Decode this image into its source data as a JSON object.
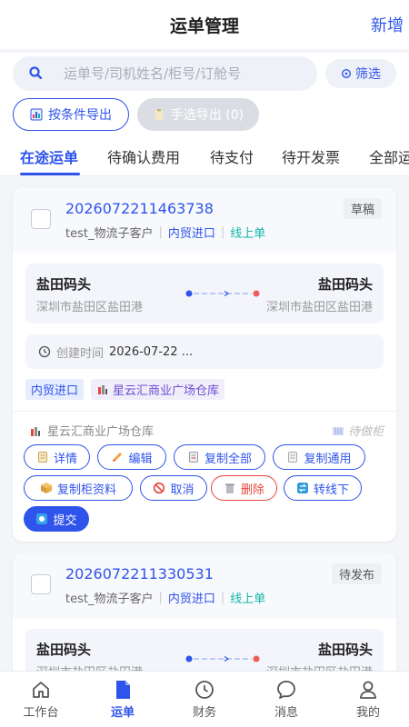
{
  "header": {
    "title": "运单管理",
    "add_label": "新增"
  },
  "search": {
    "placeholder": "运单号/司机姓名/柜号/订舱号",
    "filter_label": "筛选"
  },
  "export": {
    "by_condition": "按条件导出",
    "manual": "手选导出 (0)"
  },
  "tabs": [
    {
      "label": "在途运单",
      "active": true
    },
    {
      "label": "待确认费用"
    },
    {
      "label": "待支付"
    },
    {
      "label": "待开发票"
    },
    {
      "label": "全部运"
    }
  ],
  "orders": [
    {
      "order_no": "2026072211463738",
      "status": "草稿",
      "customer": "test_物流子客户",
      "trade_type": "内贸进口",
      "channel": "线上单",
      "from_name": "盐田码头",
      "from_addr": "深圳市盐田区盐田港",
      "to_name": "盐田码头",
      "to_addr": "深圳市盐田区盐田港",
      "created_label": "创建时间",
      "created_value": "2026-07-22 ...",
      "tag_trade": "内贸进口",
      "tag_warehouse": "星云汇商业广场仓库",
      "warehouse": "星云汇商业广场仓库",
      "container_status": "待做柜",
      "actions": {
        "detail": "详情",
        "edit": "编辑",
        "copy_all": "复制全部",
        "copy_common": "复制通用",
        "copy_container": "复制柜资料",
        "cancel": "取消",
        "delete": "删除",
        "to_offline": "转线下",
        "submit": "提交"
      }
    },
    {
      "order_no": "2026072211330531",
      "status": "待发布",
      "customer": "test_物流子客户",
      "trade_type": "内贸进口",
      "channel": "线上单",
      "from_name": "盐田码头",
      "from_addr": "深圳市盐田区盐田港",
      "to_name": "盐田码头",
      "to_addr": "深圳市盐田区盐田港"
    }
  ],
  "tabbar": [
    {
      "label": "工作台",
      "icon": "home-icon"
    },
    {
      "label": "运单",
      "icon": "document-icon",
      "active": true
    },
    {
      "label": "财务",
      "icon": "clock-icon"
    },
    {
      "label": "消息",
      "icon": "chat-icon"
    },
    {
      "label": "我的",
      "icon": "user-icon"
    }
  ],
  "colors": {
    "primary": "#2f54eb",
    "danger": "#e8453c",
    "online": "#10b8a6"
  }
}
